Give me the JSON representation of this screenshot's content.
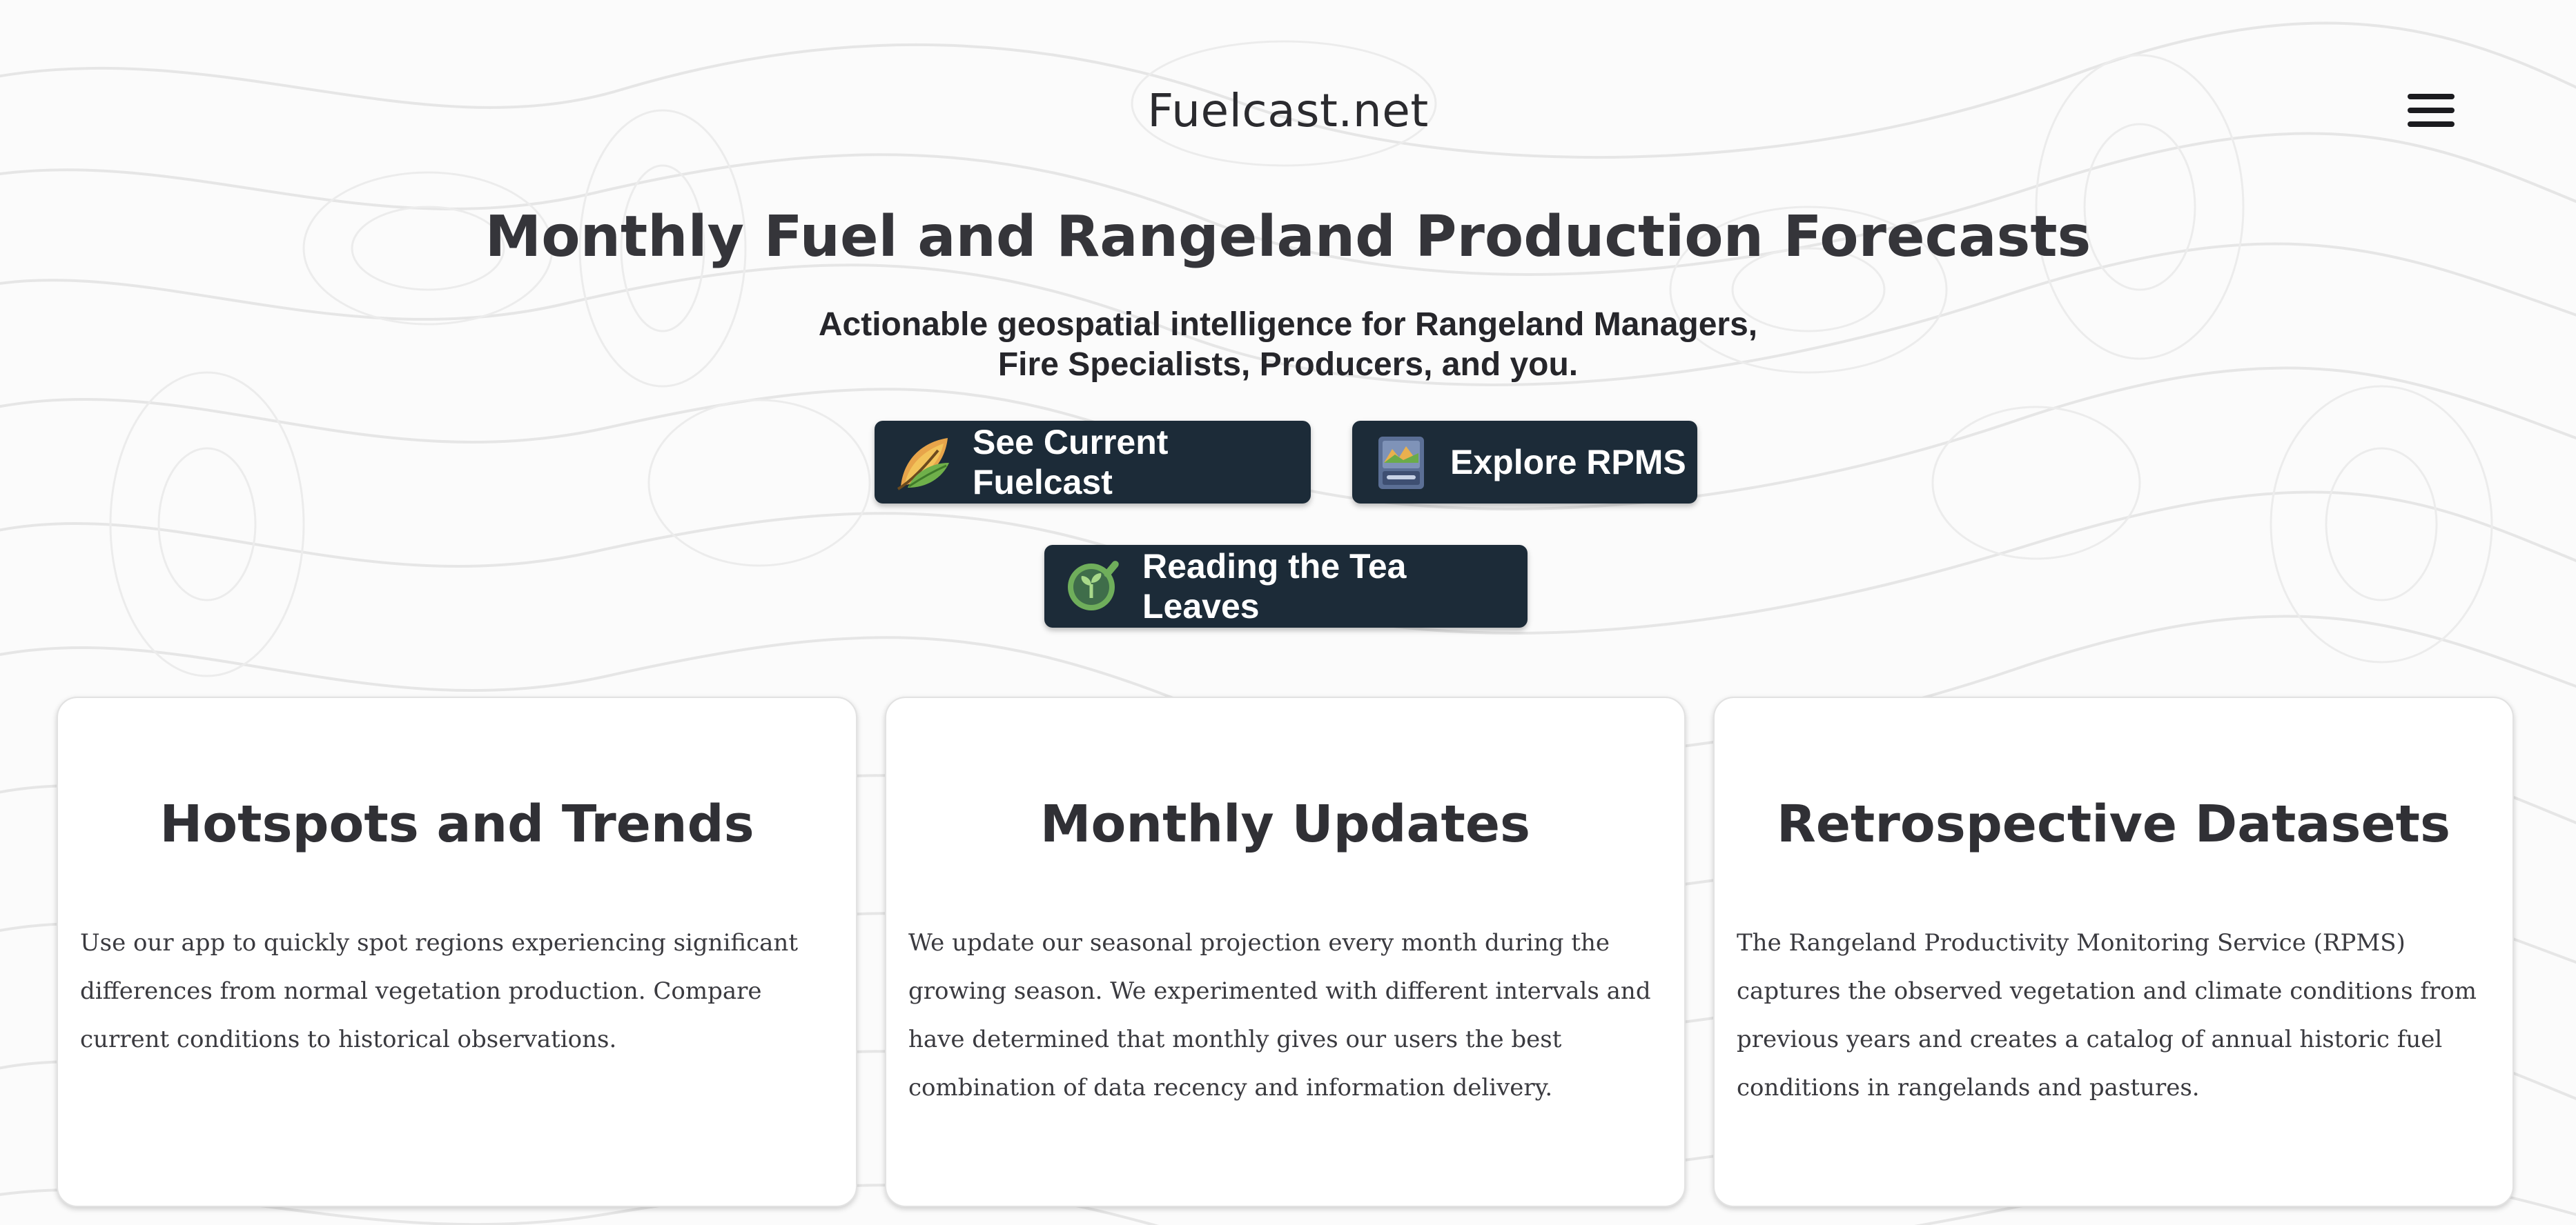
{
  "header": {
    "site_title": "Fuelcast.net",
    "menu_icon": "hamburger-menu-icon"
  },
  "hero": {
    "title": "Monthly Fuel and Rangeland Production Forecasts",
    "subtitle": "Actionable geospatial intelligence for Rangeland Managers, Fire Specialists, Producers, and you."
  },
  "buttons": [
    {
      "label": "See Current Fuelcast",
      "icon": "leaf-icon"
    },
    {
      "label": "Explore RPMS",
      "icon": "folder-map-icon"
    },
    {
      "label": "Reading the Tea Leaves",
      "icon": "sprout-magnifier-icon"
    }
  ],
  "features": [
    {
      "title": "Hotspots and Trends",
      "text": "Use our app to quickly spot regions experiencing significant differences from normal vegetation production. Compare current conditions to historical observations."
    },
    {
      "title": "Monthly Updates",
      "text": "We update our seasonal projection every month during the growing season. We experimented with different intervals and have determined that monthly gives our users the best combination of data recency and information delivery."
    },
    {
      "title": "Retrospective Datasets",
      "text": "The Rangeland Productivity Monitoring Service (RPMS) captures the observed vegetation and climate conditions from previous years and creates a catalog of annual historic fuel conditions in rangelands and pastures."
    }
  ],
  "colors": {
    "button_background": "#1c2b38",
    "button_text": "#ffffff",
    "page_background": "#fbfbfb",
    "heading_text": "#35353a"
  }
}
